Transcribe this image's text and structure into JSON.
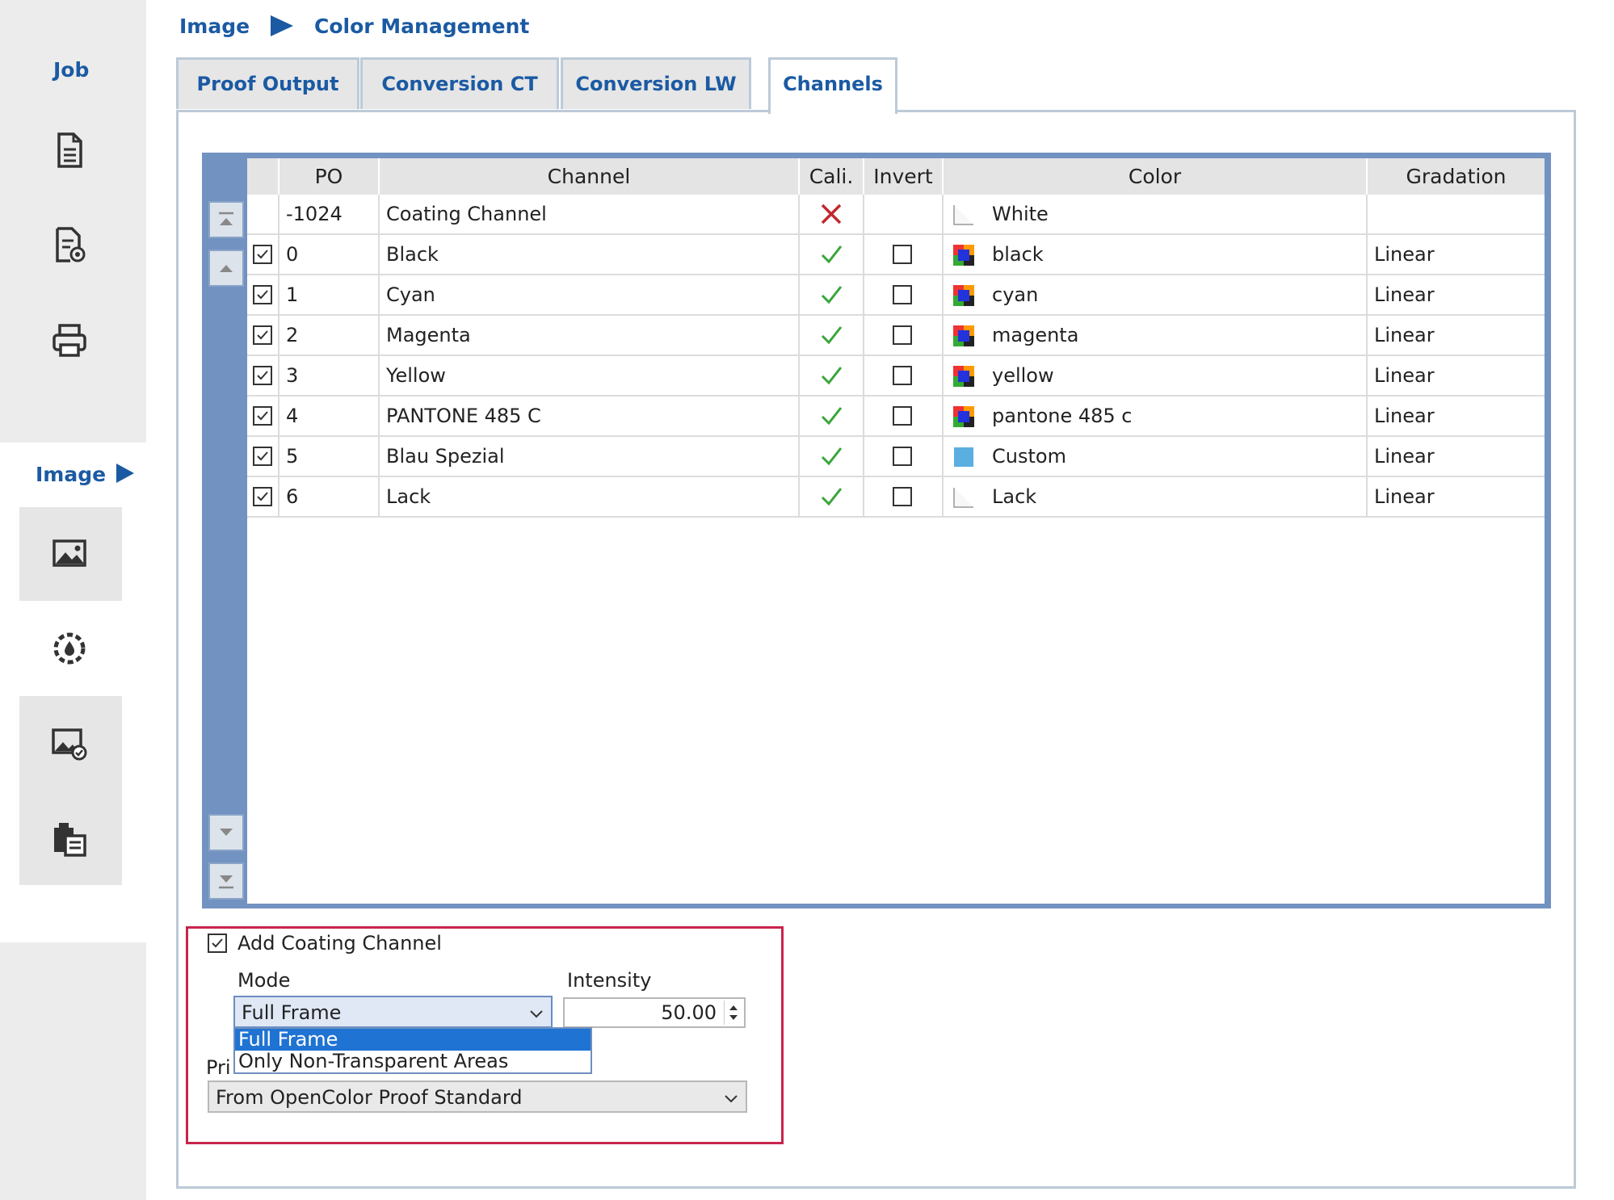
{
  "sidebar": {
    "job_label": "Job",
    "image_label": "Image",
    "job_icons": [
      "document-icon",
      "document-settings-icon",
      "printer-icon"
    ],
    "image_icons": [
      "picture-icon",
      "color-wheel-icon",
      "image-settings-icon",
      "clipboard-icon"
    ]
  },
  "breadcrumb": {
    "level1": "Image",
    "level2": "Color Management"
  },
  "tabs": [
    {
      "label": "Proof Output",
      "active": false
    },
    {
      "label": "Conversion CT",
      "active": false
    },
    {
      "label": "Conversion LW",
      "active": false
    },
    {
      "label": "Channels",
      "active": true
    }
  ],
  "table": {
    "headers": {
      "po": "PO",
      "channel": "Channel",
      "cali": "Cali.",
      "invert": "Invert",
      "color": "Color",
      "gradation": "Gradation"
    },
    "rows": [
      {
        "enabled": null,
        "po": "-1024",
        "channel": "Coating Channel",
        "cali": "fail",
        "invert": null,
        "swatch": "blank",
        "color": "White",
        "gradation": ""
      },
      {
        "enabled": true,
        "po": "0",
        "channel": "Black",
        "cali": "ok",
        "invert": false,
        "swatch": "multi",
        "color": "black",
        "gradation": "Linear"
      },
      {
        "enabled": true,
        "po": "1",
        "channel": "Cyan",
        "cali": "ok",
        "invert": false,
        "swatch": "multi",
        "color": "cyan",
        "gradation": "Linear"
      },
      {
        "enabled": true,
        "po": "2",
        "channel": "Magenta",
        "cali": "ok",
        "invert": false,
        "swatch": "multi",
        "color": "magenta",
        "gradation": "Linear"
      },
      {
        "enabled": true,
        "po": "3",
        "channel": "Yellow",
        "cali": "ok",
        "invert": false,
        "swatch": "multi",
        "color": "yellow",
        "gradation": "Linear"
      },
      {
        "enabled": true,
        "po": "4",
        "channel": "PANTONE 485 C",
        "cali": "ok",
        "invert": false,
        "swatch": "multi",
        "color": "pantone 485 c",
        "gradation": "Linear"
      },
      {
        "enabled": true,
        "po": "5",
        "channel": "Blau Spezial",
        "cali": "ok",
        "invert": false,
        "swatch": "custom",
        "color": "Custom",
        "gradation": "Linear"
      },
      {
        "enabled": true,
        "po": "6",
        "channel": "Lack",
        "cali": "ok",
        "invert": false,
        "swatch": "blank",
        "color": "Lack",
        "gradation": "Linear"
      }
    ]
  },
  "coating": {
    "add_label": "Add Coating Channel",
    "add_checked": true,
    "mode_label": "Mode",
    "mode_value": "Full Frame",
    "mode_options": [
      "Full Frame",
      "Only Non-Transparent Areas"
    ],
    "intensity_label": "Intensity",
    "intensity_value": "50.00",
    "priority_label_partial": "Pri",
    "priority_value": "From OpenColor Proof Standard"
  },
  "colors": {
    "accent": "#1b5aa3",
    "table_frame": "#7292c1",
    "highlight_box": "#c8244c",
    "check_ok": "#3aa53a",
    "check_fail": "#c0282c",
    "dropdown_selected": "#1f73d2"
  }
}
